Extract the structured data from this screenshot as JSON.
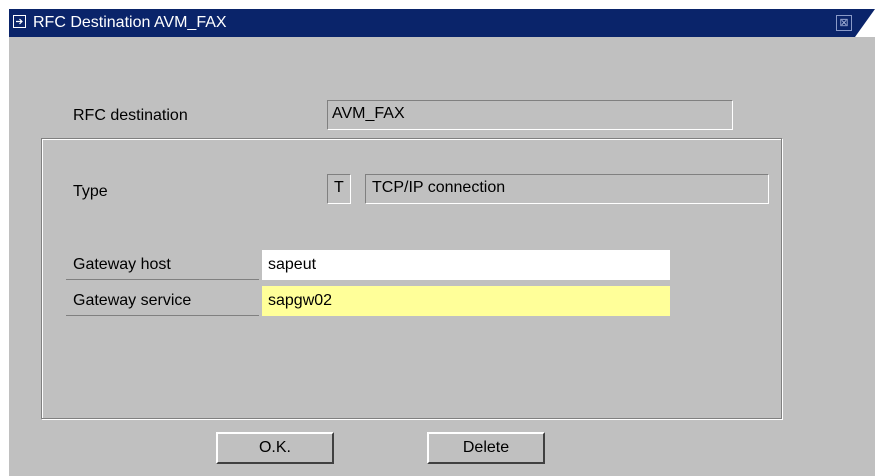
{
  "window": {
    "title": "RFC Destination AVM_FAX",
    "close_glyph": "⊠"
  },
  "destination": {
    "label": "RFC destination",
    "value": "AVM_FAX"
  },
  "type": {
    "label": "Type",
    "code": "T",
    "description": "TCP/IP connection"
  },
  "gateway": {
    "host_label": "Gateway host",
    "host_value": "sapeut",
    "service_label": "Gateway service",
    "service_value": "sapgw02"
  },
  "buttons": {
    "ok_label": "O.K.",
    "delete_label": "Delete"
  },
  "colors": {
    "window_bg": "#c0c0c0",
    "title_bar": "#0a246a",
    "required_field": "#ffff99",
    "input_bg": "#ffffff"
  }
}
